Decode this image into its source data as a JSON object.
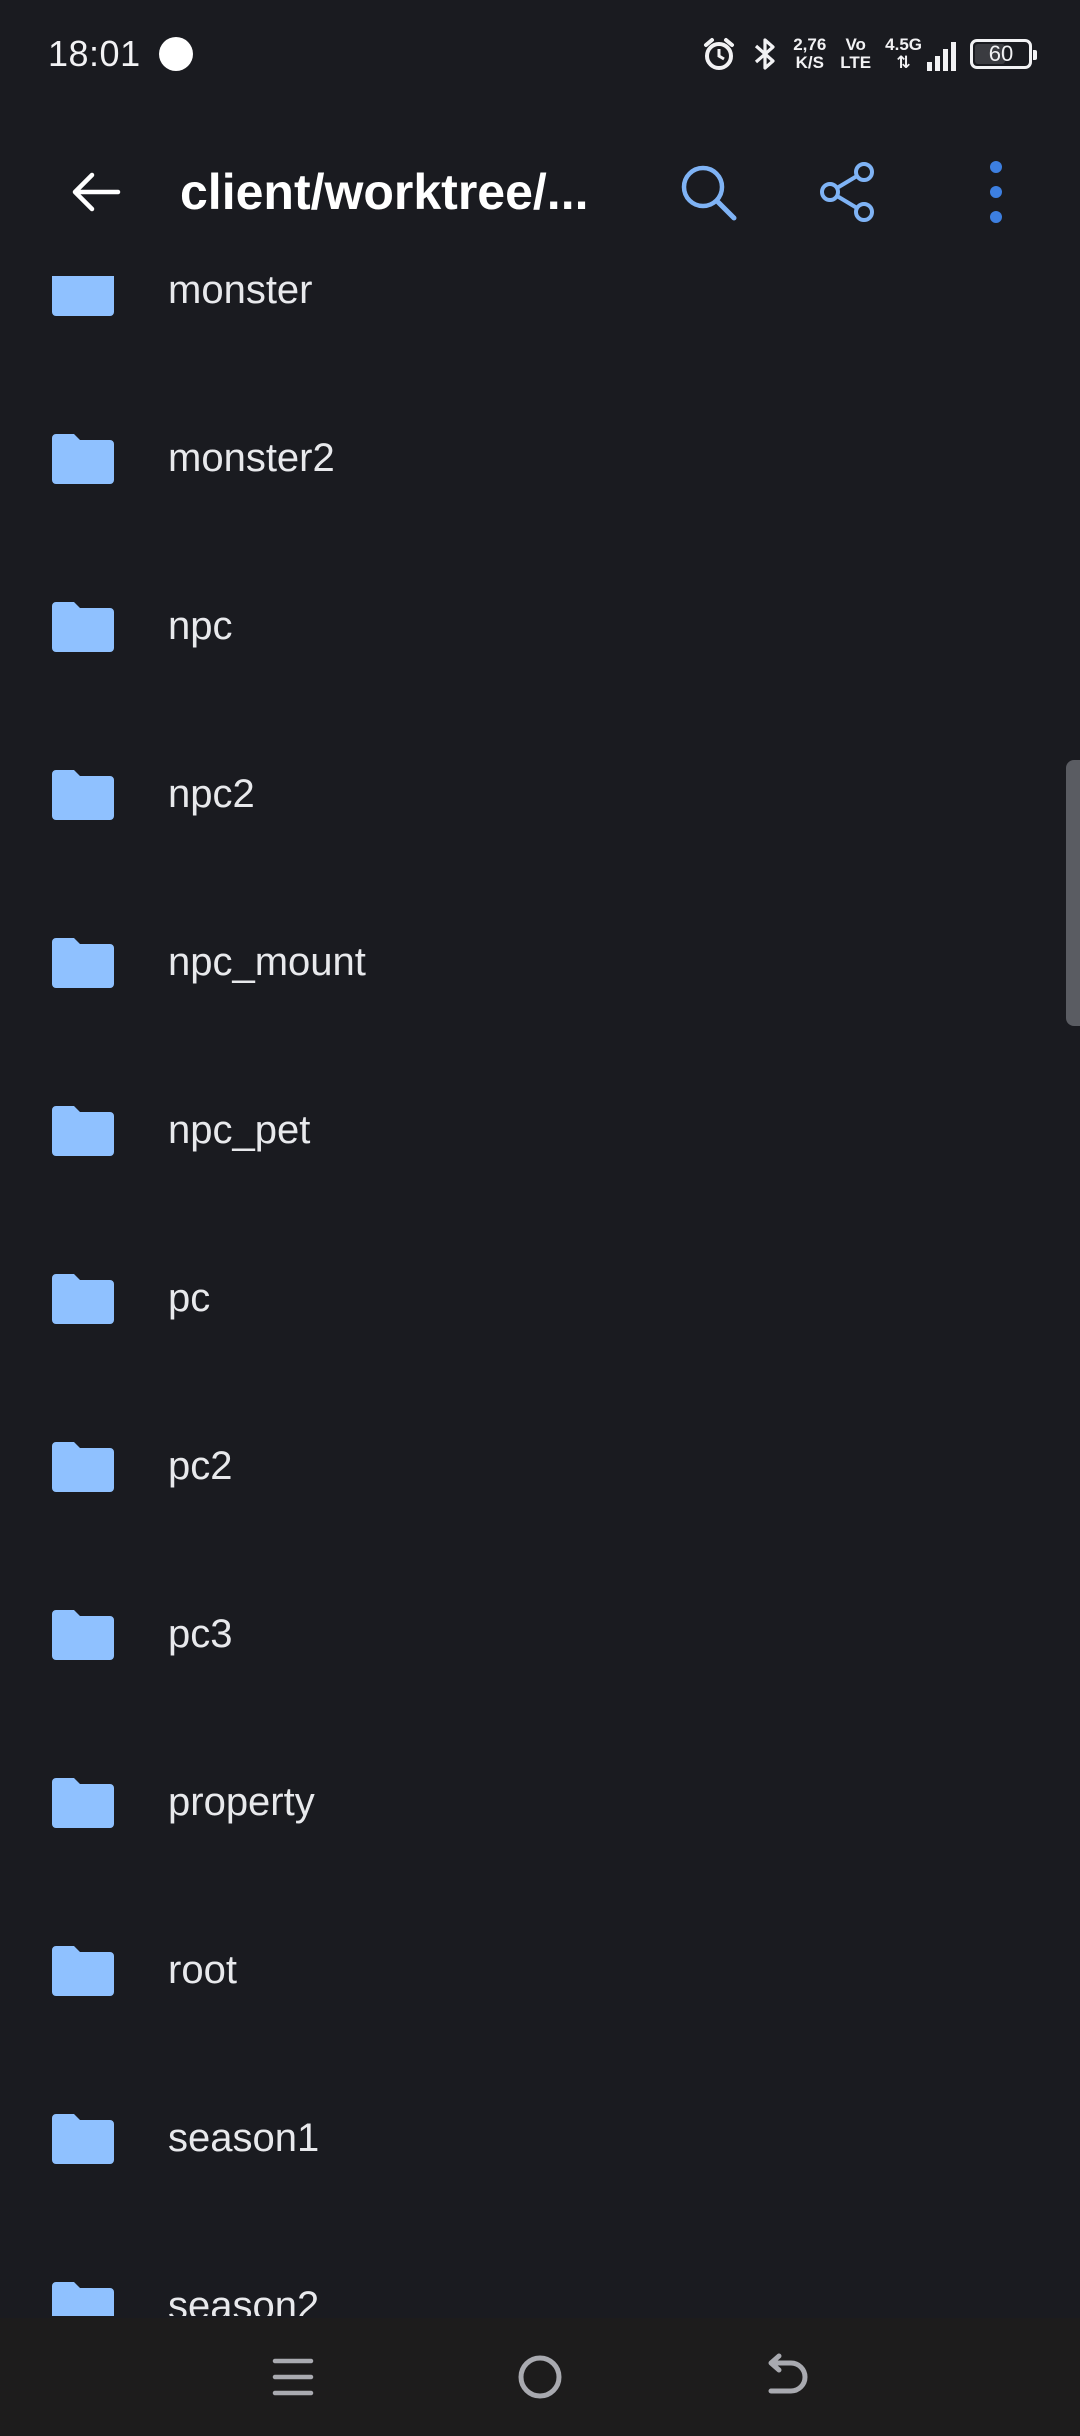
{
  "status_bar": {
    "time": "18:01",
    "net_speed_value": "2,76",
    "net_speed_unit": "K/S",
    "volte_top": "Vo",
    "volte_bottom": "LTE",
    "network_type": "4.5G",
    "battery_level": "60",
    "battery_fraction": 0.6
  },
  "app_bar": {
    "title": "client/worktree/..."
  },
  "folders": [
    {
      "name": "monster"
    },
    {
      "name": "monster2"
    },
    {
      "name": "npc"
    },
    {
      "name": "npc2"
    },
    {
      "name": "npc_mount"
    },
    {
      "name": "npc_pet"
    },
    {
      "name": "pc"
    },
    {
      "name": "pc2"
    },
    {
      "name": "pc3"
    },
    {
      "name": "property"
    },
    {
      "name": "root"
    },
    {
      "name": "season1"
    },
    {
      "name": "season2"
    }
  ],
  "colors": {
    "background": "#1a1b20",
    "folder_icon": "#8fc1ff",
    "accent_icon": "#7fb3f5",
    "menu_dots": "#3d7fe0"
  },
  "icons": {
    "back": "arrow-left-icon",
    "search": "search-icon",
    "share": "share-icon",
    "menu": "more-vert-icon",
    "folder": "folder-icon"
  }
}
